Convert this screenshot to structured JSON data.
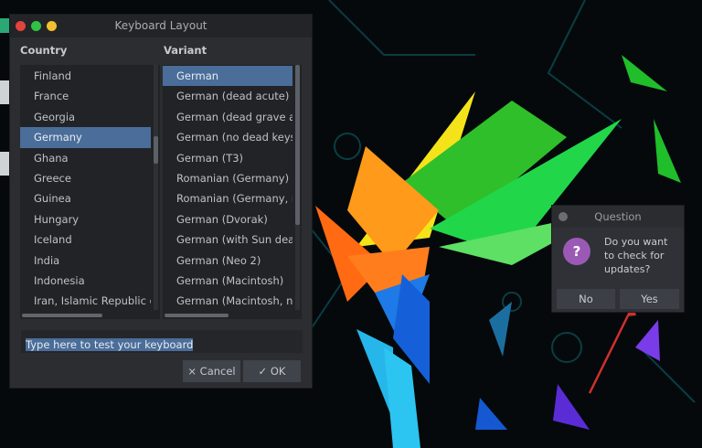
{
  "keyboard_dialog": {
    "title": "Keyboard Layout",
    "country_label": "Country",
    "variant_label": "Variant",
    "countries": [
      "Finland",
      "France",
      "Georgia",
      "Germany",
      "Ghana",
      "Greece",
      "Guinea",
      "Hungary",
      "Iceland",
      "India",
      "Indonesia",
      "Iran, Islamic Republic of"
    ],
    "selected_country": "Germany",
    "variants": [
      "German",
      "German (dead acute)",
      "German (dead grave acute)",
      "German (no dead keys)",
      "German (T3)",
      "Romanian (Germany)",
      "Romanian (Germany, no dead keys)",
      "German (Dvorak)",
      "German (with Sun dead keys)",
      "German (Neo 2)",
      "German (Macintosh)",
      "German (Macintosh, no dead keys)"
    ],
    "selected_variant": "German",
    "test_input_value": "Type here to test your keyboard",
    "cancel_label": "× Cancel",
    "ok_label": "✓ OK"
  },
  "question_dialog": {
    "title": "Question",
    "message": "Do you want to check for updates?",
    "icon": "question-icon",
    "no_label": "No",
    "yes_label": "Yes",
    "icon_color": "#9b59b6"
  },
  "colors": {
    "selection": "#4a6d99",
    "close": "#e0443e",
    "minimize": "#2fc246",
    "maximize": "#f3bf2f"
  }
}
